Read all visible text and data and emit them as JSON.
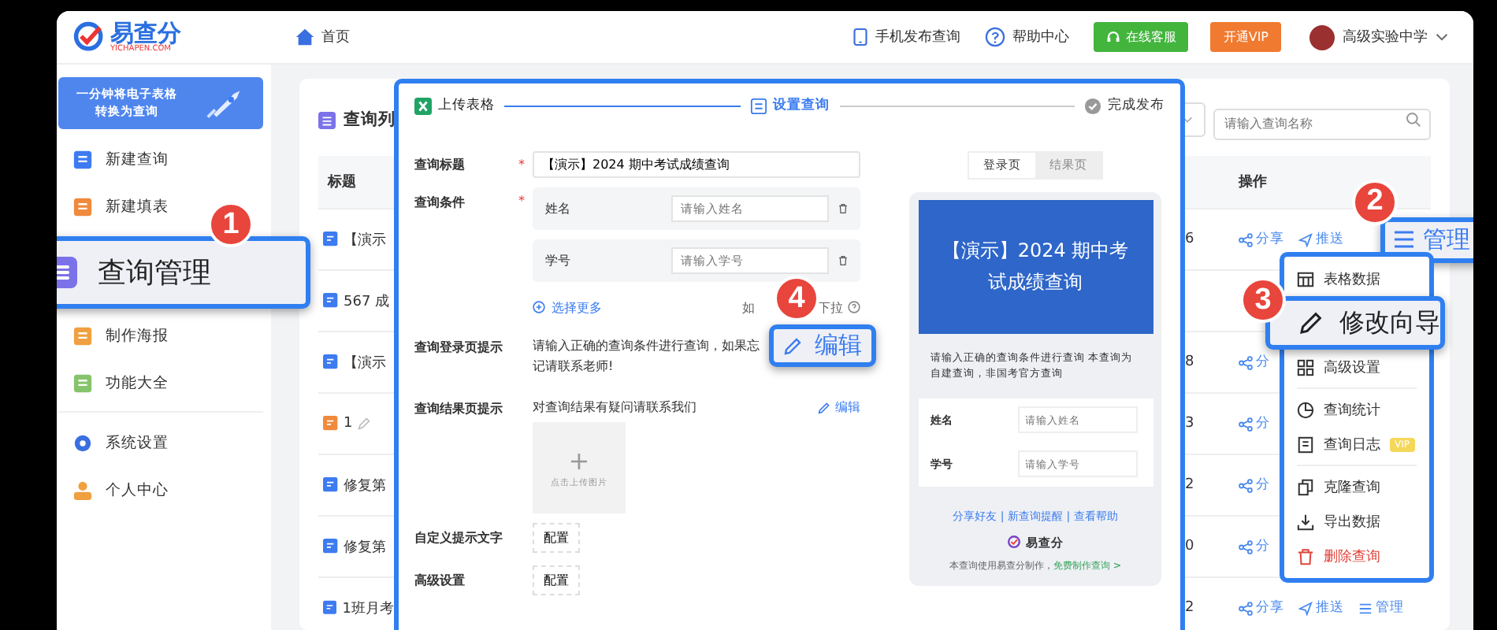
{
  "header": {
    "logo_name": "易查分",
    "logo_domain": "YICHAPEN.COM",
    "nav": [
      "首页"
    ],
    "links": [
      "手机发布查询",
      "帮助中心"
    ],
    "service_button": "在线客服",
    "vip_button": "开通VIP",
    "user": "高级实验中学"
  },
  "sidebar": {
    "banner": [
      "一分钟将电子表格",
      "转换为查询"
    ],
    "groups": [
      [
        {
          "label": "新建查询",
          "selected": false
        },
        {
          "label": "新建填表",
          "selected": false
        },
        {
          "label": "查询管理",
          "selected": true,
          "badge": "1"
        },
        {
          "label": "制作海报",
          "selected": false
        },
        {
          "label": "功能大全",
          "selected": false
        }
      ],
      [
        {
          "label": "系统设置",
          "selected": false
        },
        {
          "label": "个人中心",
          "selected": false
        }
      ]
    ]
  },
  "list": {
    "title": "查询列",
    "search_placeholder": "请输入查询名称",
    "columns": [
      "标题",
      "操作"
    ],
    "rows": [
      {
        "title": "【演示",
        "kind": "query",
        "count": "6",
        "actions": [
          {
            "label": "分享",
            "kind": "share",
            "selected": false
          },
          {
            "label": "推送",
            "kind": "send",
            "selected": false
          },
          {
            "label": "管理",
            "kind": "manage",
            "selected": true,
            "badge": "2"
          }
        ]
      },
      {
        "title": "567 成",
        "kind": "query"
      },
      {
        "title": "【演示",
        "kind": "query",
        "count": "8",
        "actions": [
          {
            "label": "分",
            "kind": "share",
            "selected": false
          }
        ]
      },
      {
        "title": "1",
        "kind": "form",
        "count": "3",
        "actions": [
          {
            "label": "分",
            "kind": "share",
            "selected": false
          }
        ]
      },
      {
        "title": "修复第",
        "kind": "query",
        "count": "2",
        "actions": [
          {
            "label": "分",
            "kind": "share",
            "selected": false
          }
        ]
      },
      {
        "title": "修复第",
        "kind": "query",
        "count": "0",
        "actions": [
          {
            "label": "分",
            "kind": "share",
            "selected": false
          }
        ]
      },
      {
        "title": "1班月考",
        "kind": "query",
        "count": "2",
        "actions": [
          {
            "label": "分享",
            "kind": "share",
            "selected": false
          },
          {
            "label": "推送",
            "kind": "send",
            "selected": false
          },
          {
            "label": "管理",
            "kind": "manage",
            "selected": false
          }
        ]
      }
    ]
  },
  "dialog": {
    "steps": [
      {
        "label": "上传表格",
        "completed": true,
        "selected": false
      },
      {
        "label": "设置查询",
        "completed": false,
        "selected": true
      },
      {
        "label": "完成发布",
        "completed": false,
        "selected": false
      }
    ],
    "form": {
      "title_field": {
        "label": "查询标题",
        "required_mark": "*",
        "value": "【演示】2024 期中考试成绩查询"
      },
      "conditions": {
        "label": "查询条件",
        "required_mark": "*",
        "items": [
          {
            "name": "姓名",
            "placeholder": "请输入姓名"
          },
          {
            "name": "学号",
            "placeholder": "请输入学号"
          }
        ],
        "more": "选择更多",
        "hint": [
          "如",
          "下拉"
        ]
      },
      "login_tip": {
        "label": "查询登录页提示",
        "text": "请输入正确的查询条件进行查询，如果忘记请联系老师!",
        "edit": {
          "label": "编辑",
          "selected": true,
          "badge": "4"
        }
      },
      "result_tip": {
        "label": "查询结果页提示",
        "text": "对查询结果有疑问请联系我们",
        "edit": {
          "label": "编辑",
          "selected": false
        },
        "upload_plus": "+",
        "upload": "点击上传图片"
      },
      "config_rows": [
        {
          "label": "自定义提示文字",
          "button": "配置"
        },
        {
          "label": "高级设置",
          "button": "配置"
        }
      ]
    },
    "preview": {
      "tabs": [
        {
          "label": "登录页",
          "selected": true
        },
        {
          "label": "结果页",
          "selected": false
        }
      ],
      "title": "【演示】2024 期中考试成绩查询",
      "notice": "请输入正确的查询条件进行查询 本查询为自建查询，非国考官方查询",
      "fields": [
        {
          "label": "姓名",
          "placeholder": "请输入姓名"
        },
        {
          "label": "学号",
          "placeholder": "请输入学号"
        }
      ],
      "links": "分享好友 | 新查询提醒 | 查看帮助",
      "brand": "易查分",
      "footer": "本查询使用易查分制作，",
      "footer_link": "免费制作查询 >"
    }
  },
  "menu": {
    "groups": [
      [
        {
          "label": "表格数据",
          "selected": false
        },
        {
          "label": "修改向导",
          "selected": true,
          "badge": "3"
        },
        {
          "label": "高级设置",
          "selected": false
        }
      ],
      [
        {
          "label": "查询统计",
          "selected": false
        },
        {
          "label": "查询日志",
          "selected": false,
          "tag": "VIP"
        }
      ],
      [
        {
          "label": "克隆查询",
          "selected": false
        },
        {
          "label": "导出数据",
          "selected": false
        },
        {
          "label": "删除查询",
          "selected": false,
          "danger": true
        }
      ]
    ]
  }
}
